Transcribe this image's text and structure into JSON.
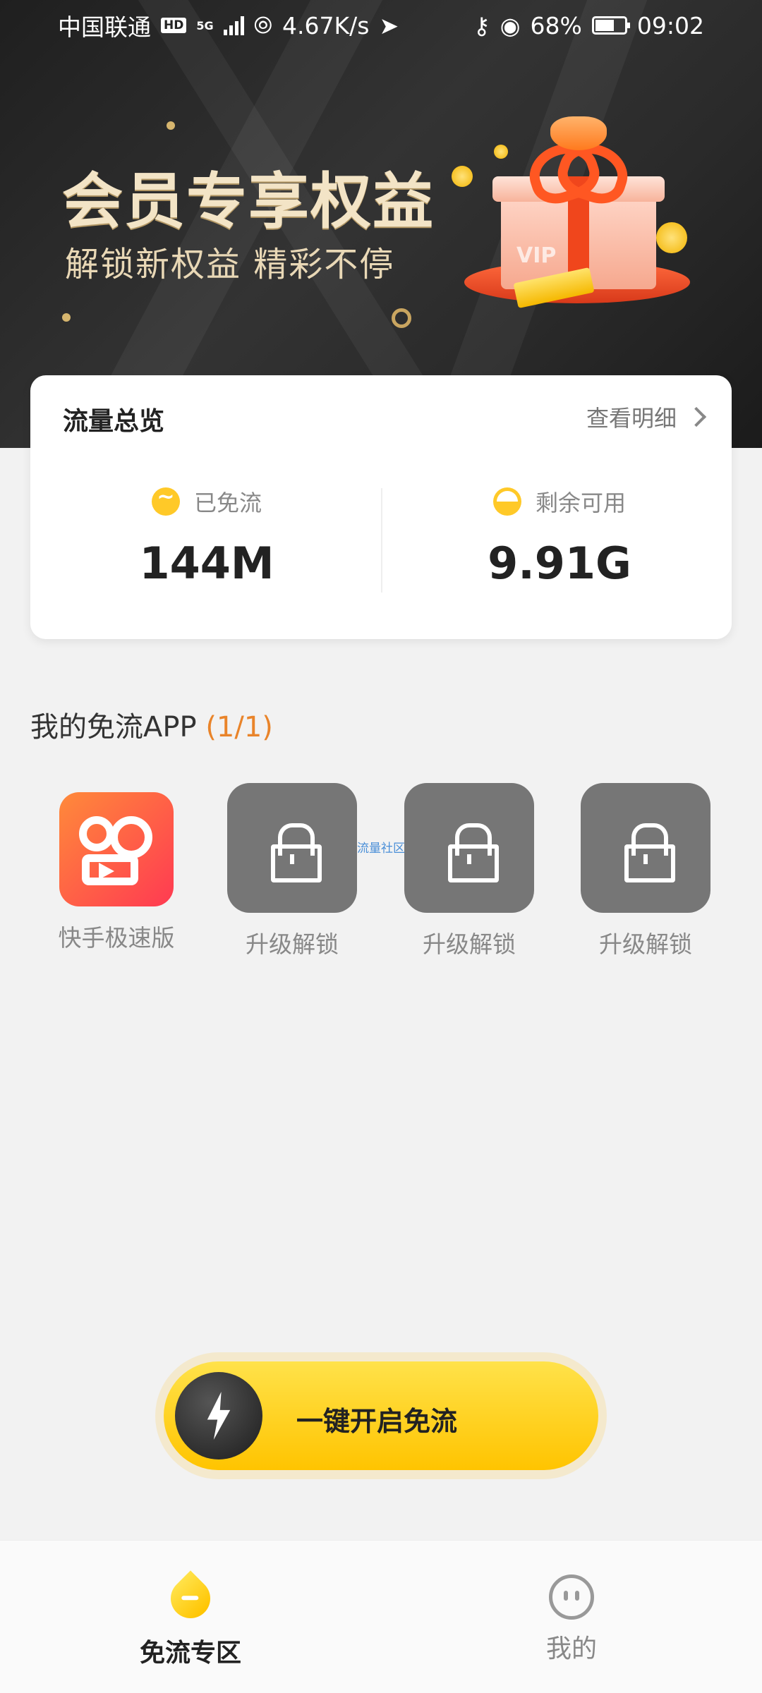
{
  "status_bar": {
    "carrier": "中国联通",
    "hd_badge": "HD",
    "network": "5G",
    "speed": "4.67K/s",
    "battery": "68%",
    "time": "09:02"
  },
  "banner": {
    "title": "会员专享权益",
    "subtitle": "解锁新权益  精彩不停",
    "gift_text": "VIP"
  },
  "overview": {
    "title": "流量总览",
    "detail_link": "查看明细",
    "used_label": "已免流",
    "used_value": "144M",
    "remaining_label": "剩余可用",
    "remaining_value": "9.91G"
  },
  "my_apps": {
    "title": "我的免流APP",
    "count": "(1/1)",
    "items": [
      {
        "label": "快手极速版",
        "locked": false,
        "icon": "kuaishou-icon"
      },
      {
        "label": "升级解锁",
        "locked": true,
        "icon": "lock-icon"
      },
      {
        "label": "升级解锁",
        "locked": true,
        "icon": "lock-icon"
      },
      {
        "label": "升级解锁",
        "locked": true,
        "icon": "lock-icon"
      }
    ],
    "floating_tag": "流量社区"
  },
  "main_button": {
    "label": "一键开启免流"
  },
  "bottom_nav": {
    "items": [
      {
        "label": "免流专区",
        "active": true,
        "icon": "drop-icon"
      },
      {
        "label": "我的",
        "active": false,
        "icon": "face-icon"
      }
    ]
  },
  "colors": {
    "accent": "#ffc928",
    "count_orange": "#e9842a",
    "banner_gold": "#f3e4c6"
  }
}
